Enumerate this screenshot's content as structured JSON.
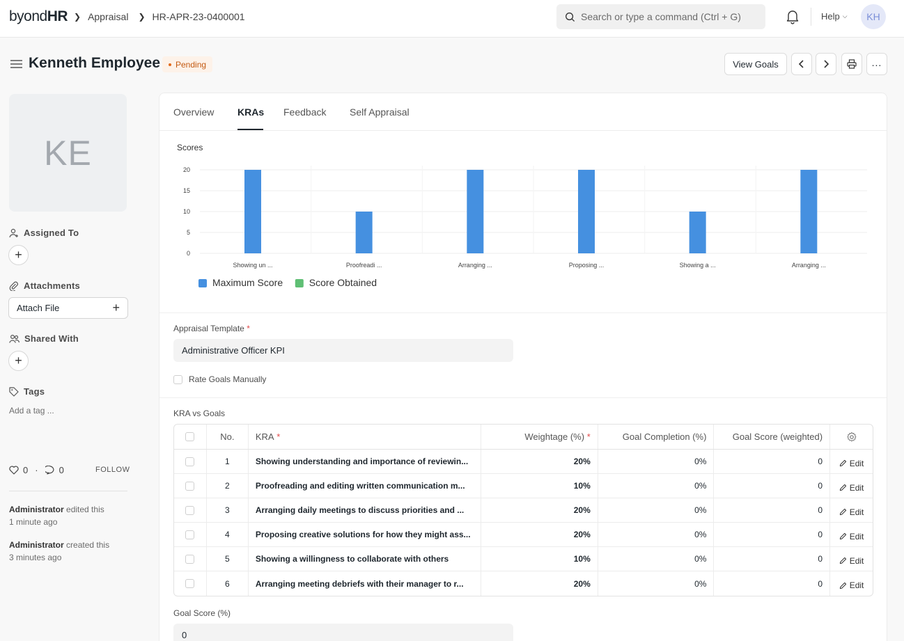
{
  "navbar": {
    "logo_a": "byond",
    "logo_b": "HR",
    "breadcrumbs": [
      "Appraisal",
      "HR-APR-23-0400001"
    ],
    "search_placeholder": "Search or type a command (Ctrl + G)",
    "help_label": "Help",
    "user_initials": "KH"
  },
  "header": {
    "title": "Kenneth Employee",
    "status": "Pending",
    "view_goals_label": "View Goals"
  },
  "sidebar": {
    "avatar_initials": "KE",
    "assigned_to_label": "Assigned To",
    "attachments_label": "Attachments",
    "attach_file_label": "Attach File",
    "shared_with_label": "Shared With",
    "tags_label": "Tags",
    "add_tag_placeholder": "Add a tag ...",
    "likes": "0",
    "comments": "0",
    "follow_label": "FOLLOW",
    "activity": [
      {
        "who": "Administrator",
        "what": "edited this",
        "when": "1 minute ago"
      },
      {
        "who": "Administrator",
        "what": "created this",
        "when": "3 minutes ago"
      }
    ]
  },
  "tabs": [
    "Overview",
    "KRAs",
    "Feedback",
    "Self Appraisal"
  ],
  "chart_title": "Scores",
  "chart_data": {
    "type": "bar",
    "categories": [
      "Showing un ...",
      "Proofreadi ...",
      "Arranging ...",
      "Proposing ...",
      "Showing a ...",
      "Arranging ..."
    ],
    "series": [
      {
        "name": "Maximum Score",
        "values": [
          20,
          10,
          20,
          20,
          10,
          20
        ],
        "color": "#4590e0"
      },
      {
        "name": "Score Obtained",
        "values": [
          0,
          0,
          0,
          0,
          0,
          0
        ],
        "color": "#5fbf74"
      }
    ],
    "yticks": [
      "0",
      "5",
      "10",
      "15",
      "20"
    ],
    "ylim": [
      0,
      20
    ],
    "legend": "bottom-left"
  },
  "form": {
    "template_label": "Appraisal Template",
    "template_value": "Administrative Officer KPI",
    "rate_manually_label": "Rate Goals Manually",
    "kra_vs_goals_label": "KRA vs Goals",
    "goal_score_label": "Goal Score (%)",
    "goal_score_value": "0"
  },
  "table": {
    "headers": {
      "no": "No.",
      "kra": "KRA",
      "weightage": "Weightage (%)",
      "completion": "Goal Completion (%)",
      "score": "Goal Score (weighted)"
    },
    "edit_label": "Edit",
    "rows": [
      {
        "no": "1",
        "kra": "Showing understanding and importance of reviewin...",
        "weightage": "20%",
        "completion": "0%",
        "score": "0"
      },
      {
        "no": "2",
        "kra": "Proofreading and editing written communication m...",
        "weightage": "10%",
        "completion": "0%",
        "score": "0"
      },
      {
        "no": "3",
        "kra": "Arranging daily meetings to discuss priorities and ...",
        "weightage": "20%",
        "completion": "0%",
        "score": "0"
      },
      {
        "no": "4",
        "kra": "Proposing creative solutions for how they might ass...",
        "weightage": "20%",
        "completion": "0%",
        "score": "0"
      },
      {
        "no": "5",
        "kra": "Showing a willingness to collaborate with others",
        "weightage": "10%",
        "completion": "0%",
        "score": "0"
      },
      {
        "no": "6",
        "kra": "Arranging meeting debriefs with their manager to r...",
        "weightage": "20%",
        "completion": "0%",
        "score": "0"
      }
    ]
  }
}
